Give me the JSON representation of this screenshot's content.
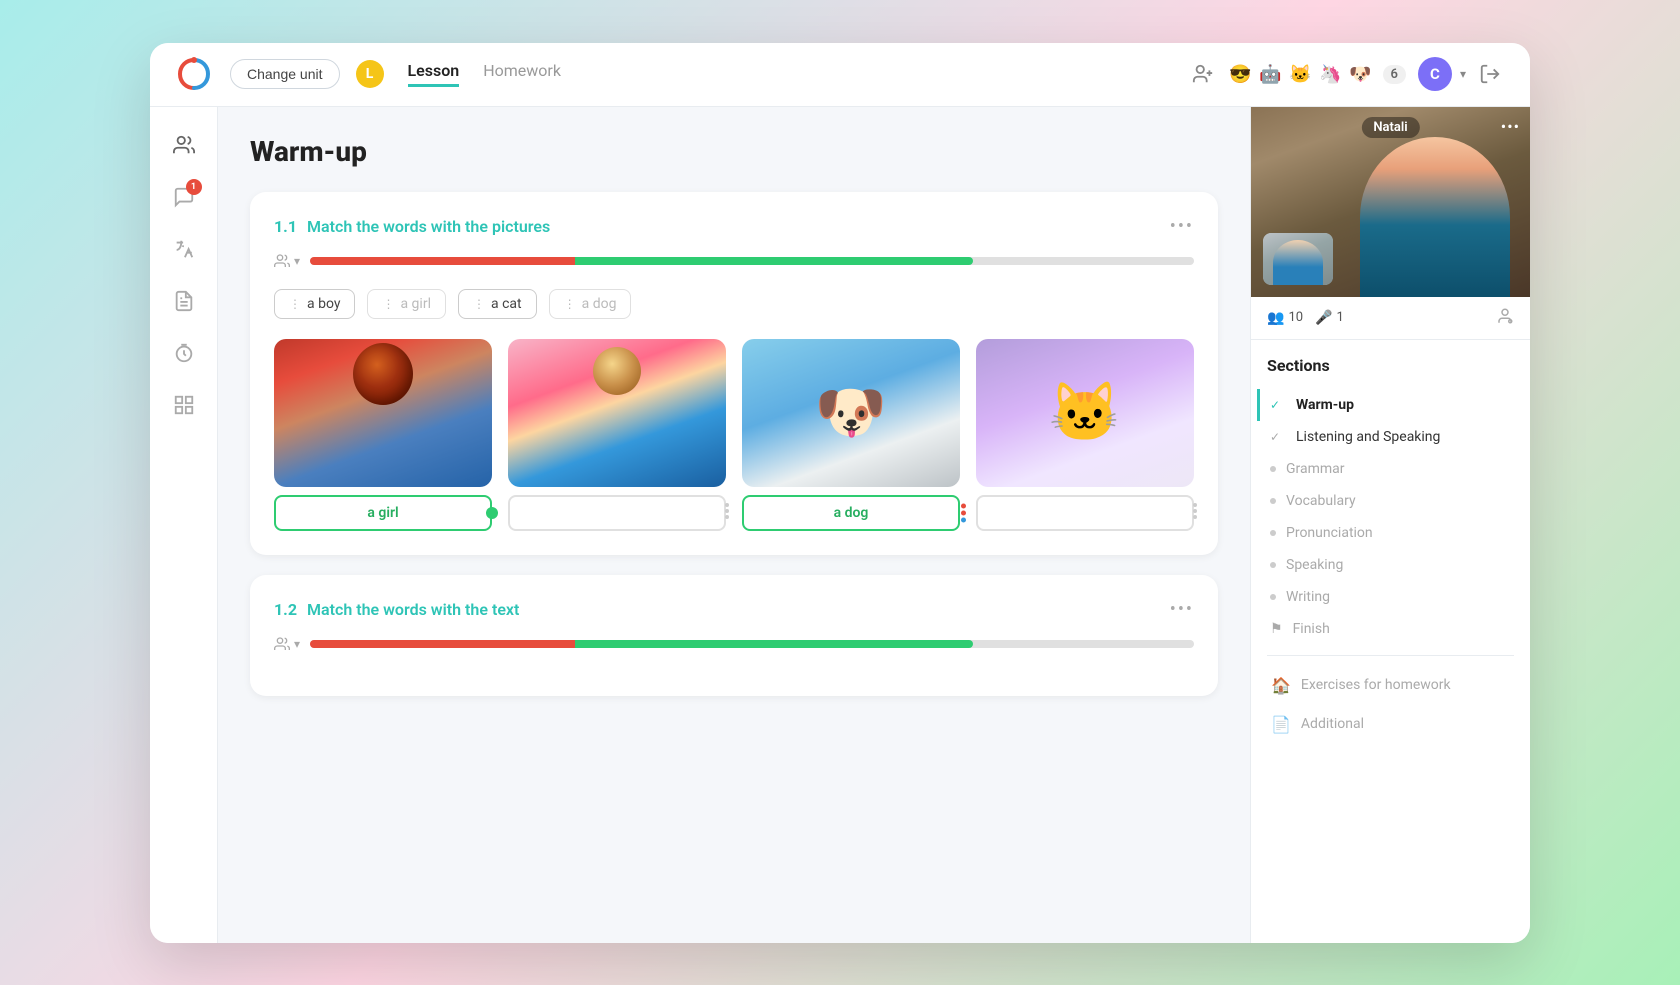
{
  "header": {
    "change_unit_label": "Change unit",
    "unit_letter": "L",
    "tab_lesson": "Lesson",
    "tab_homework": "Homework",
    "user_count": "6",
    "user_initial": "C"
  },
  "sidebar": {
    "icons": [
      {
        "name": "people-icon",
        "badge": null
      },
      {
        "name": "chat-icon",
        "badge": "1"
      },
      {
        "name": "translate-icon",
        "badge": null
      },
      {
        "name": "notes-icon",
        "badge": null
      },
      {
        "name": "timer-icon",
        "badge": null
      },
      {
        "name": "grid-icon",
        "badge": null
      }
    ]
  },
  "lesson": {
    "title": "Warm-up",
    "exercises": [
      {
        "num": "1.1",
        "label": "Match the words with the pictures",
        "words": [
          "a boy",
          "a girl",
          "a cat",
          "a dog"
        ],
        "images": [
          {
            "type": "girl",
            "answer": "a girl",
            "status": "correct"
          },
          {
            "type": "boy",
            "answer": "",
            "status": "empty"
          },
          {
            "type": "dog",
            "answer": "a dog",
            "status": "correct"
          },
          {
            "type": "cat",
            "answer": "",
            "status": "wrong"
          }
        ]
      },
      {
        "num": "1.2",
        "label": "Match the words with the text"
      }
    ]
  },
  "video": {
    "name": "Natali",
    "participants": "10",
    "mics": "1"
  },
  "sections": {
    "title": "Sections",
    "items": [
      {
        "label": "Warm-up",
        "status": "active",
        "checked": true
      },
      {
        "label": "Listening and Speaking",
        "status": "checked",
        "checked": true
      },
      {
        "label": "Grammar",
        "status": "dot"
      },
      {
        "label": "Vocabulary",
        "status": "dot"
      },
      {
        "label": "Pronunciation",
        "status": "dot"
      },
      {
        "label": "Speaking",
        "status": "dot"
      },
      {
        "label": "Writing",
        "status": "dot"
      },
      {
        "label": "Finish",
        "status": "flag"
      }
    ],
    "extras": [
      {
        "label": "Exercises for homework",
        "icon": "house"
      },
      {
        "label": "Additional",
        "icon": "document"
      }
    ]
  }
}
